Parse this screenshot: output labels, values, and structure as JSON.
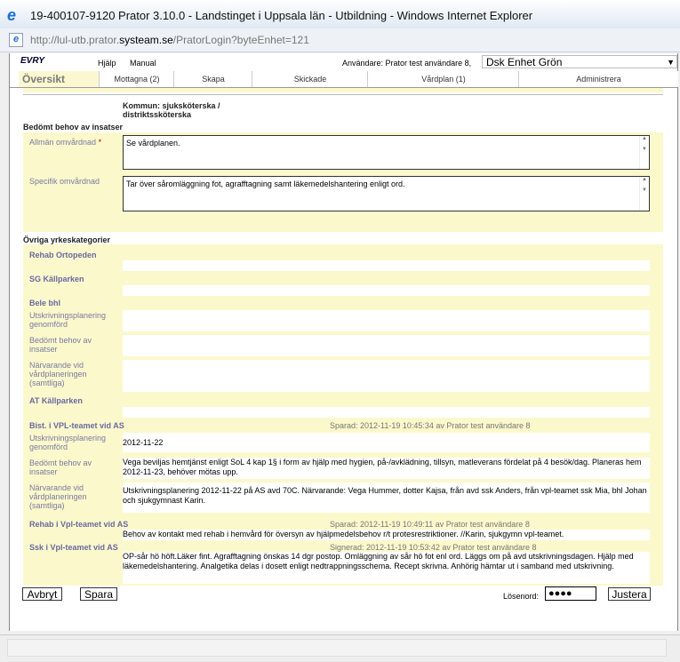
{
  "window": {
    "title": "19-400107-9120  Prator 3.10.0 - Landstinget i Uppsala län - Utbildning - Windows Internet Explorer",
    "url_prefix": "http://lul-utb.prator.",
    "url_domain": "systeam.se",
    "url_suffix": "/PratorLogin?byteEnhet=121"
  },
  "topmenu": {
    "logo": "EVRY",
    "help": "Hjälp",
    "manual": "Manual",
    "user": "Användare: Prator test användare 8,",
    "unit": "Dsk Enhet Grön"
  },
  "tabs": [
    "Översikt",
    "Mottagna (2)",
    "Skapa",
    "Skickade",
    "Vårdplan (1)",
    "Administrera"
  ],
  "form": {
    "kommun_label": "Kommun: sjuksköterska / distriktssköterska",
    "bedomt_header": "Bedömt behov av insatser",
    "allman_label": "Allmän omvårdnad",
    "allman_required": "*",
    "allman_value": "Se vårdplanen.",
    "specifik_label": "Specifik omvårdnad",
    "specifik_value": "Tar över såromläggning fot, agrafftagning samt läkemedelshantering enligt ord.",
    "ovriga_header": "Övriga yrkeskategorier",
    "groups": {
      "rehab_ortopeden": "Rehab Ortopeden",
      "sg_kallparken": "SG Källparken",
      "bele_bhl": "Bele bhl",
      "at_kallparken": "AT Källparken",
      "bist_vpl": "Bist. i VPL-teamet vid AS",
      "rehab_vpl": "Rehab i Vpl-teamet vid AS",
      "ssk_vpl": "Ssk i Vpl-teamet vid AS"
    },
    "field_labels": {
      "utskrivning": "Utskrivningsplanering genomförd",
      "bedomt": "Bedömt behov av insatser",
      "narvarande": "Närvarande vid vårdplaneringen (samtliga)"
    },
    "bist": {
      "saved": "Sparad: 2012-11-19 10:45:34 av Prator test användare 8",
      "utskrivning": "2012-11-22",
      "bedomt": "Vega beviljas hemtjänst enligt SoL 4 kap 1§ i form av hjälp med hygien, på-/avklädning, tillsyn, matleverans fördelat på 4 besök/dag. Planeras hem 2012-11-23, behöver mötas upp.",
      "narvarande": "Utskrivningsplanering 2012-11-22 på AS avd 70C. Närvarande: Vega Hummer, dotter Kajsa, från avd ssk Anders, från vpl-teamet ssk Mia, bhl Johan och sjukgymnast Karin."
    },
    "rehab": {
      "saved": "Sparad: 2012-11-19 10:49:11 av Prator test användare 8",
      "text": "Behov av kontakt med rehab i hemvård för översyn av hjälpmedelsbehov r/t protesrestriktioner. //Karin, sjukgymn vpl-teamet."
    },
    "ssk": {
      "signed": "Signerad: 2012-11-19 10:53:42 av Prator test användare 8",
      "text": "OP-sår hö höft.Läker fint. Agrafftagning önskas 14 dgr postop. Omläggning av sår hö fot enl ord. Läggs om på avd utskrivningsdagen. Hjälp med läkemedelshantering. Analgetika delas i dosett enligt nedtrappningsschema. Recept skrivna. Anhörig hämtar ut i samband med utskrivning."
    }
  },
  "buttons": {
    "cancel": "Avbryt",
    "save": "Spara",
    "password_label": "Lösenord:",
    "password_value": "●●●●",
    "adjust": "Justera"
  }
}
